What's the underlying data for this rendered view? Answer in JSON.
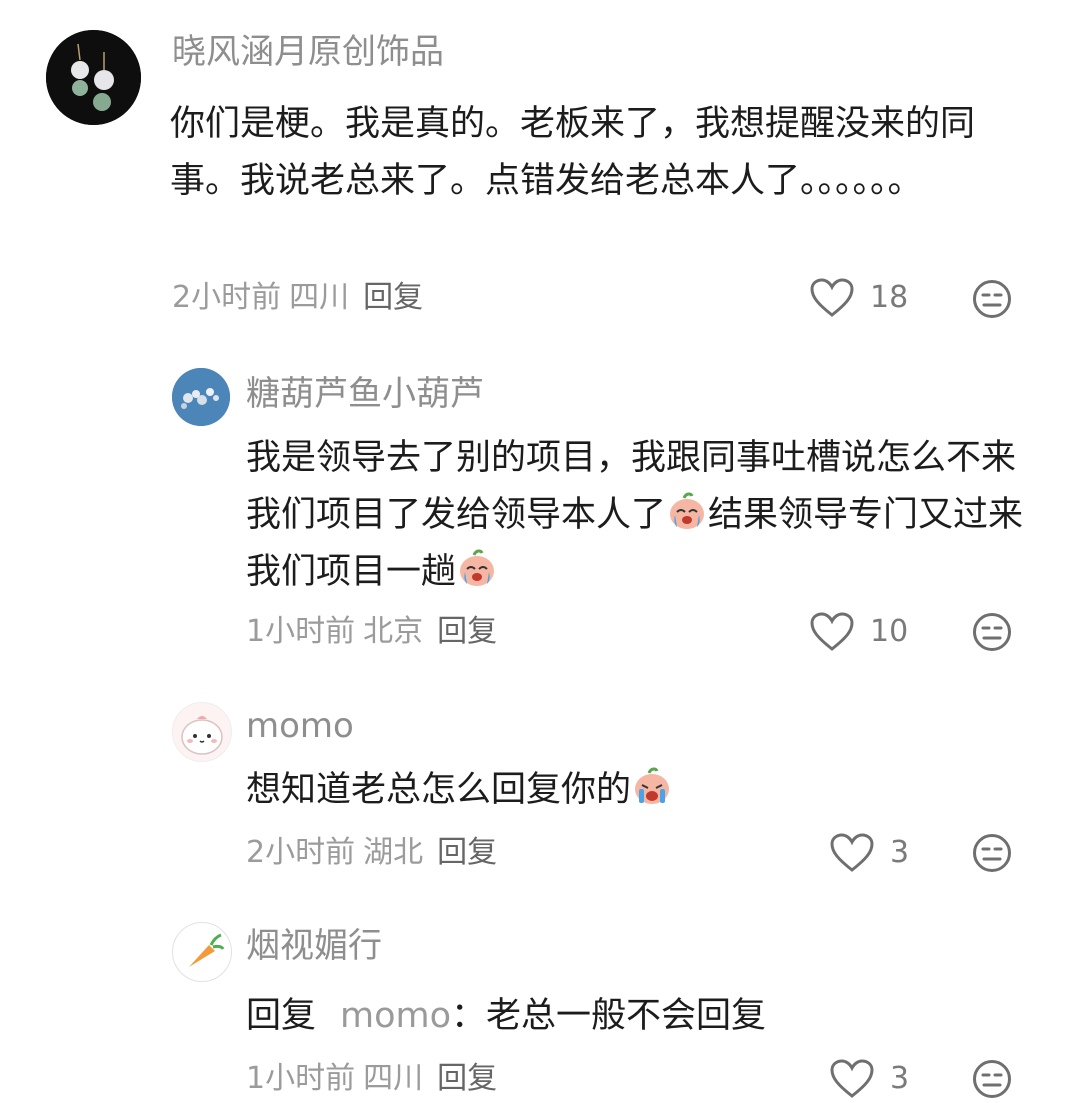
{
  "comments": [
    {
      "username": "晓风涵月原创饰品",
      "text": "你们是梗。我是真的。老板来了，我想提醒没来的同事。我说老总来了。点错发给老总本人了。。。。。。",
      "time": "2小时前",
      "location": "四川",
      "reply_label": "回复",
      "likes": "18"
    },
    {
      "username": "糖葫芦鱼小葫芦",
      "text_part1": "我是领导去了别的项目，我跟同事吐槽说怎么不来我们项目了发给领导本人了",
      "text_part2": "结果领导专门又过来我们项目一趟",
      "time": "1小时前",
      "location": "北京",
      "reply_label": "回复",
      "likes": "10"
    },
    {
      "username": "momo",
      "text": "想知道老总怎么回复你的",
      "time": "2小时前",
      "location": "湖北",
      "reply_label": "回复",
      "likes": "3"
    },
    {
      "username": "烟视媚行",
      "reply_prefix": "回复",
      "reply_to": "momo",
      "text": "：老总一般不会回复",
      "time": "1小时前",
      "location": "四川",
      "reply_label": "回复",
      "likes": "3"
    }
  ],
  "icons": {
    "like": "heart-outline-icon",
    "dislike": "neutral-face-icon",
    "emoji_cry": "crying-face-emoji",
    "emoji_sob": "sobbing-face-emoji"
  },
  "colors": {
    "username": "#8e8e8e",
    "text": "#1c1c1c",
    "meta": "#9b9b9b"
  }
}
